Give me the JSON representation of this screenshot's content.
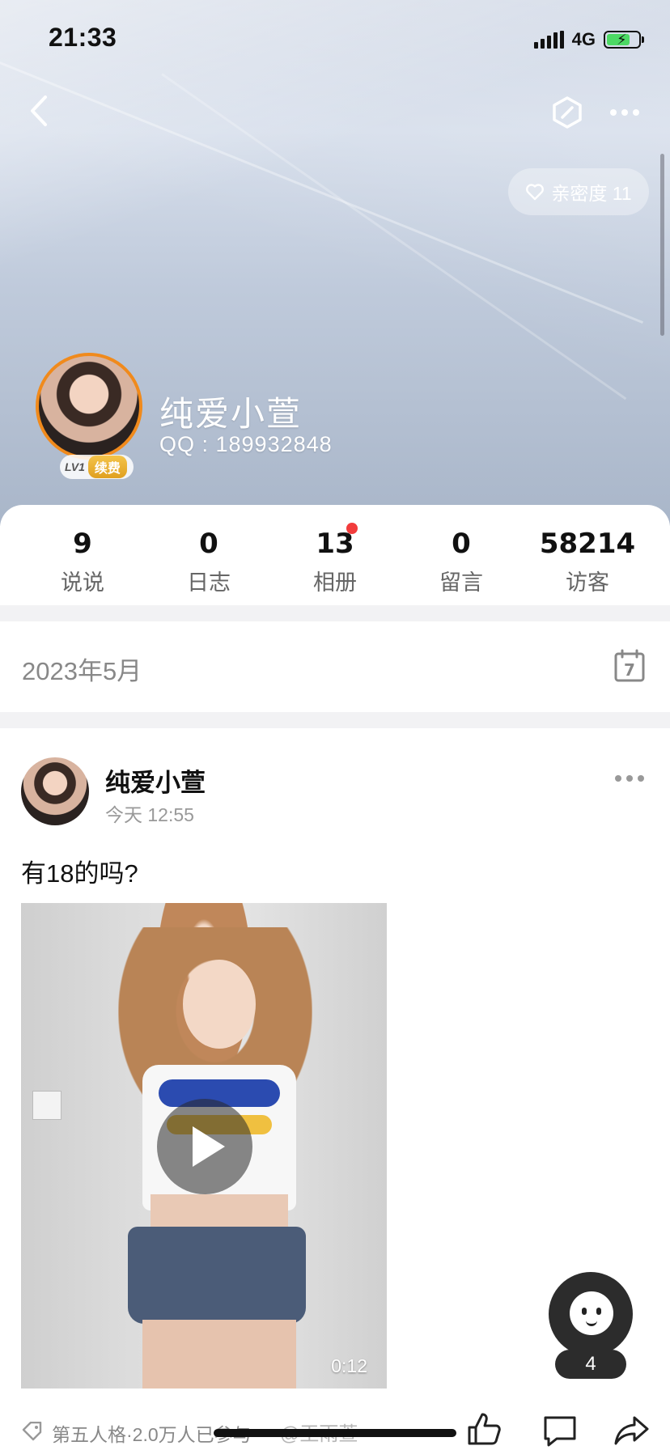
{
  "status_bar": {
    "time": "21:33",
    "network": "4G"
  },
  "header": {
    "intimacy_label": "亲密度 11",
    "name": "纯爱小萱",
    "qq": "QQ : 189932848",
    "level": "LV1",
    "renew_label": "续费"
  },
  "stats": [
    {
      "count": "9",
      "label": "说说"
    },
    {
      "count": "0",
      "label": "日志"
    },
    {
      "count": "13",
      "label": "相册"
    },
    {
      "count": "0",
      "label": "留言"
    },
    {
      "count": "58214",
      "label": "访客"
    }
  ],
  "timeline": {
    "month": "2023年5月",
    "calendar_day": "7"
  },
  "post": {
    "author": "纯爱小萱",
    "time": "今天 12:55",
    "text": "有18的吗?",
    "video_duration": "0:12"
  },
  "floating": {
    "count": "4"
  },
  "footer": {
    "tag_text": "第五人格·2.0万人已参与",
    "watermark": "@王雨萱"
  },
  "icons": {
    "back": "chevron-left-icon",
    "hex": "hexagon-icon",
    "more": "more-dots-icon",
    "heart": "heart-outline-icon",
    "calendar": "calendar-icon",
    "play": "play-icon",
    "like": "thumbs-up-icon",
    "comment": "comment-icon",
    "share": "share-icon",
    "tag": "tag-icon"
  },
  "colors": {
    "accent_orange": "#f08a1c",
    "notify_red": "#f23c3c",
    "battery_green": "#4cd964"
  }
}
